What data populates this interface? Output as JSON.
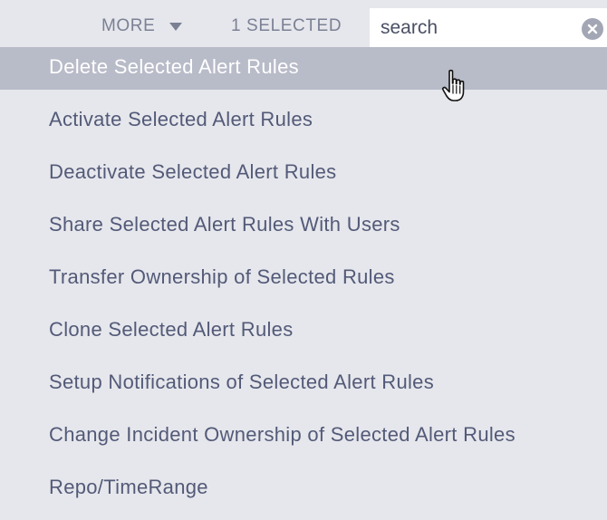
{
  "toolbar": {
    "more_label": "MORE",
    "selected_label": "1 SELECTED",
    "search_placeholder": "search"
  },
  "menu": {
    "items": [
      {
        "label": "Delete Selected Alert Rules"
      },
      {
        "label": "Activate Selected Alert Rules"
      },
      {
        "label": "Deactivate Selected Alert Rules"
      },
      {
        "label": "Share Selected Alert Rules With Users"
      },
      {
        "label": "Transfer Ownership of Selected Rules"
      },
      {
        "label": "Clone Selected Alert Rules"
      },
      {
        "label": "Setup Notifications of Selected Alert Rules"
      },
      {
        "label": "Change Incident Ownership of Selected Alert Rules"
      },
      {
        "label": "Repo/TimeRange"
      }
    ]
  },
  "icons": {
    "more_dropdown": "caret-down-icon",
    "search_clear": "close-circle-icon",
    "cursor": "hand-pointer-icon"
  },
  "colors": {
    "background": "#e6e7ec",
    "highlight": "#b8bbc8",
    "menu_text": "#535a78",
    "toolbar_text": "#7b8095"
  }
}
